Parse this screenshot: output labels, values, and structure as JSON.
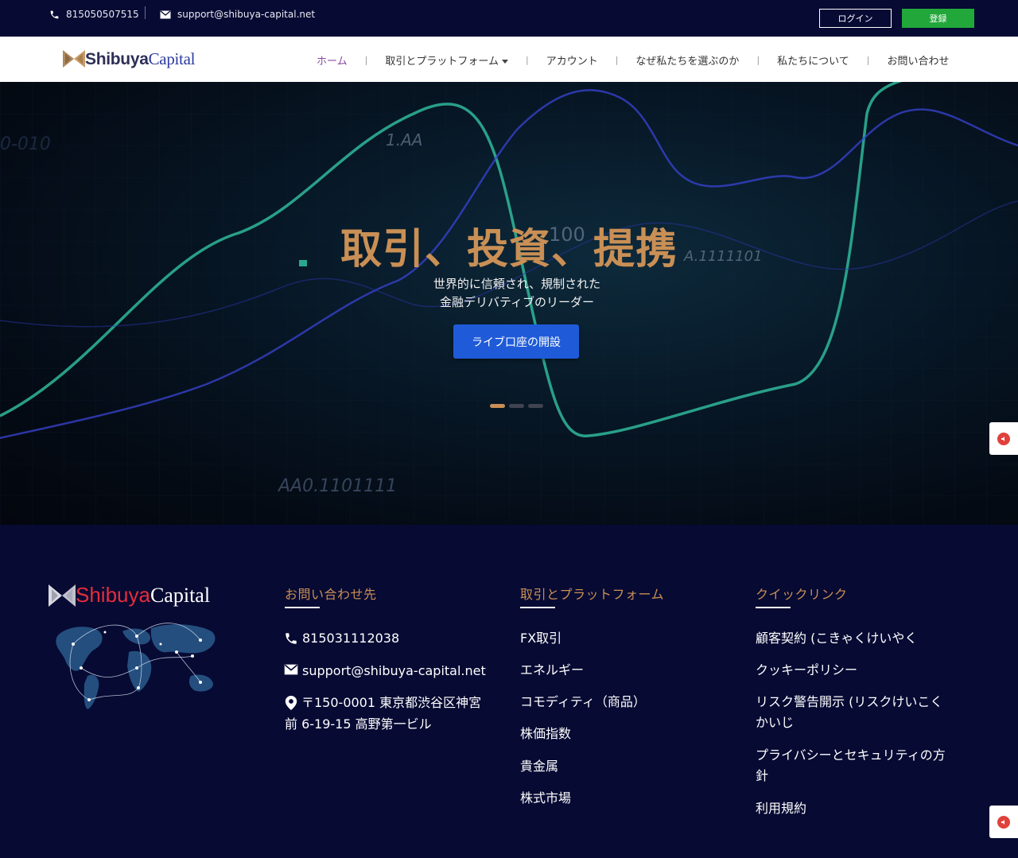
{
  "topbar": {
    "phone": "815050507515",
    "email": "support@shibuya-capital.net",
    "login_label": "ログイン",
    "register_label": "登録"
  },
  "brand": {
    "name_bold": "Shibuya",
    "name_regular": "Capital"
  },
  "nav": {
    "items": [
      {
        "label": "ホーム",
        "active": true
      },
      {
        "label": "取引とプラットフォーム",
        "has_dropdown": true
      },
      {
        "label": "アカウント"
      },
      {
        "label": "なぜ私たちを選ぶのか"
      },
      {
        "label": "私たちについて"
      },
      {
        "label": "お問い合わせ"
      }
    ]
  },
  "hero": {
    "title": "取引、投資、提携",
    "subtitle_line1": "世界的に信頼され、規制された",
    "subtitle_line2": "金融デリバティブのリーダー",
    "cta_label": "ライブ口座の開設",
    "slides_total": 3,
    "active_slide": 1
  },
  "footer": {
    "contact": {
      "heading": "お問い合わせ先",
      "phone": "815031112038",
      "email": "support@shibuya-capital.net",
      "address_line1": "〒150-0001 東京都渋谷区神宮",
      "address_line2": "前 6-19-15 高野第一ビル"
    },
    "trading": {
      "heading": "取引とプラットフォーム",
      "links": [
        "FX取引",
        "エネルギー",
        "コモディティ（商品）",
        "株価指数",
        "貴金属",
        "株式市場"
      ]
    },
    "quick": {
      "heading": "クイックリンク",
      "links": [
        {
          "line1": "顧客契約 (こきゃくけいやく",
          "line2": ""
        },
        {
          "line1": "クッキーポリシー",
          "line2": ""
        },
        {
          "line1": "リスク警告開示 (リスクけいこく",
          "line2": "かいじ"
        },
        {
          "line1": "プライバシーとセキュリティの方",
          "line2": "針"
        },
        {
          "line1": "利用規約",
          "line2": ""
        }
      ]
    }
  },
  "colors": {
    "navy": "#070a33",
    "accent_gold": "#c98f55",
    "cta_blue": "#1f5bd8",
    "register_green": "#22a83a",
    "active_nav_purple": "#8a4ca1"
  }
}
